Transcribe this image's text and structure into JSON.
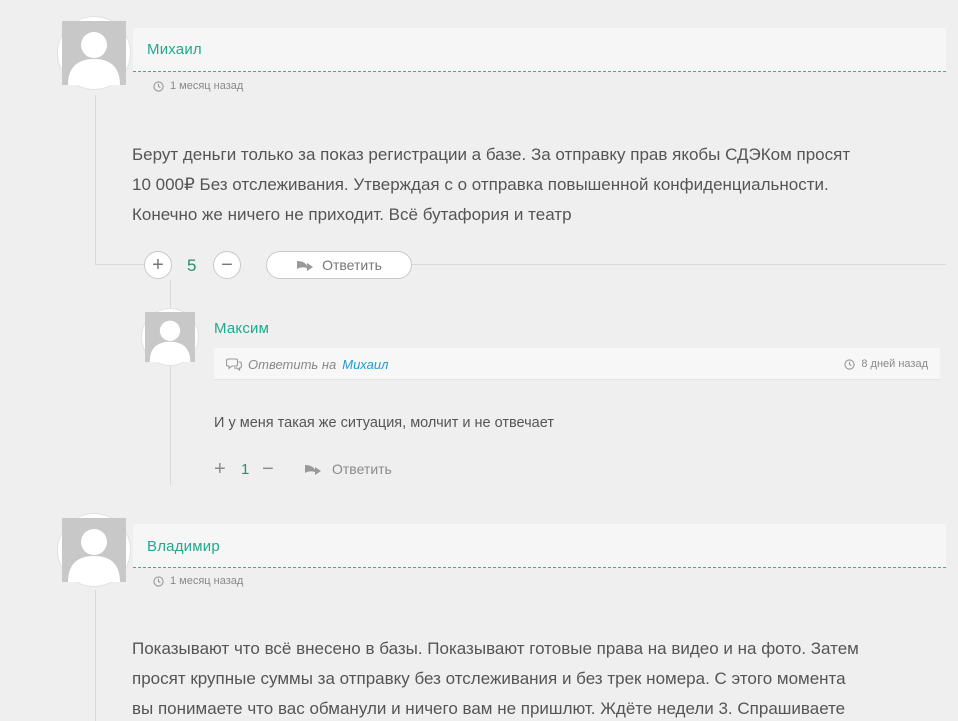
{
  "comments": [
    {
      "author": "Михаил",
      "time": "1 месяц назад",
      "lines": [
        "Берут деньги только за показ регистрации а базе. За отправку прав якобы СДЭКом просят",
        "10 000₽ Без отслеживания. Утверждая с о отправка повышенной конфиденциальности.",
        "Конечно же ничего не приходит. Всё бутафория и театр"
      ],
      "votes": "5",
      "reply_label": "Ответить",
      "replies": [
        {
          "author": "Максим",
          "reply_prefix": "Ответить на",
          "reply_target": "Михаил",
          "time": "8 дней назад",
          "text": "И у меня такая же ситуация, молчит и не отвечает",
          "votes": "1",
          "reply_label": "Ответить"
        }
      ]
    },
    {
      "author": "Владимир",
      "time": "1 месяц назад",
      "lines": [
        "Показывают что всё внесено в базы. Показывают готовые права на видео и на фото. Затем",
        "просят крупные суммы за отправку без отслеживания и без трек номера. С этого момента",
        "вы понимаете что вас обманули и ничего вам не пришлют. Ждёте недели 3. Спрашиваете"
      ]
    }
  ],
  "icons": {
    "plus": "+",
    "minus": "−"
  },
  "colors": {
    "author": "#20a98e",
    "vote_count": "#2c8e6b",
    "link": "#1f9ad1",
    "background": "#efefef"
  }
}
